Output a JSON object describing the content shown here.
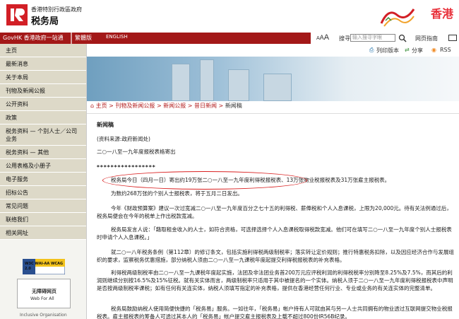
{
  "header": {
    "org": "香港特別行政區政府",
    "dept": "税务局",
    "hk": "香港"
  },
  "navbar": {
    "gov": "GovHK 香港政府一站通",
    "lang_tc": "繁體版",
    "lang_en": "ENGLISH"
  },
  "tools": {
    "font_small": "A",
    "font_med": "A",
    "font_large": "A",
    "search_label": "搜寻",
    "search_placeholder": "输入搜寻字眼",
    "site_map": "网页指南"
  },
  "sidebar": {
    "items": [
      "主页",
      "最新消息",
      "关于本局",
      "刊物及新闻公报",
      "公开资料",
      "政策",
      "税务资料 — 个别人士／公司业务",
      "税务资料 — 其他",
      "公用表格及小册子",
      "电子服务",
      "招标公告",
      "常见问题",
      "联络我们",
      "相关网址"
    ],
    "badge_wai": "W3C WAI-AA WCAG 2.0",
    "badge_web": "无障碍网页",
    "badge_web2": "Web For All",
    "badge_incl": "Inclusive Organisation"
  },
  "utility": {
    "print": "列印版本",
    "share": "分享",
    "rss": "RSS"
  },
  "breadcrumb": {
    "home": "主页",
    "pub": "刊物及新闻公报",
    "news": "新闻公报",
    "today": "昔日新闻",
    "current": "新闻稿"
  },
  "content": {
    "title": "新闻稿",
    "source": "(资料来源:政府新闻处)",
    "subject": "二○一八至一九年度报税表格寄出",
    "stars": "*****************",
    "p1": "税务局今日（四月一日）寄出约19万张二○一八至一九年度利得税报税表、13万张物业税报税表及31万张雇主报税表。",
    "p2": "为数约268万张的个别人士报税表，将于五月二日发出。",
    "p3": "今年《财政预算案》建议一次过宽减二○一八至一九年度百分之七十五的利得税、薪俸税和个人入息课税，上限为20,000元。待有关法例通过后，税务局便会在今年的税单上作出税款宽减。",
    "p4": "税务局发言人说：「藉取租金收入的人士，如符合资格，可选择选择个人入息课税取得税款宽减。他们可在填写二○一八至一九年度个别人士报税表时申请个人入息课税。」",
    "p5": "就二○一八年税务条例（第112章）的修订条文，包括实施利得税两级制税率；落实转让定价规则；推行特惠税务扣除，以及因应经济合作与发展组织的要求，监察税务优惠措施，部分纳税人须由二○一八至一九课税年度起提交利得税报税表的补充表格。",
    "p6": "利得税两级制税率由二○一八至一九课税年度起实施，法团及非法团业务首200万元应评税利润的利得税税率分别降至8.25%及7.5%，而其后的利润则继续分别按16.5%及15%征税。就有关实体而言，两级制税率只适用于其中被提名的一个实体。纳税人须于二○一八至一九年度利得税报税表中声明是否按两级制税率课税；如有任何有关连实体，纳税人须填写指定的补充表格，提供在香港经营任何行业、专业或业务的有关连实体的完整清单。",
    "p7": "税务局鼓励纳税人使用简便快捷的「税务易」服务。一如往年，「税务易」帐户持有人可就由其与另一人士共同拥有的物业透过互联网提交物业税报税表。雇主报税表的筹备人可透过其本人的「税务易」帐户提交雇主报税表及上载不超过800份IR56B纪录。"
  }
}
